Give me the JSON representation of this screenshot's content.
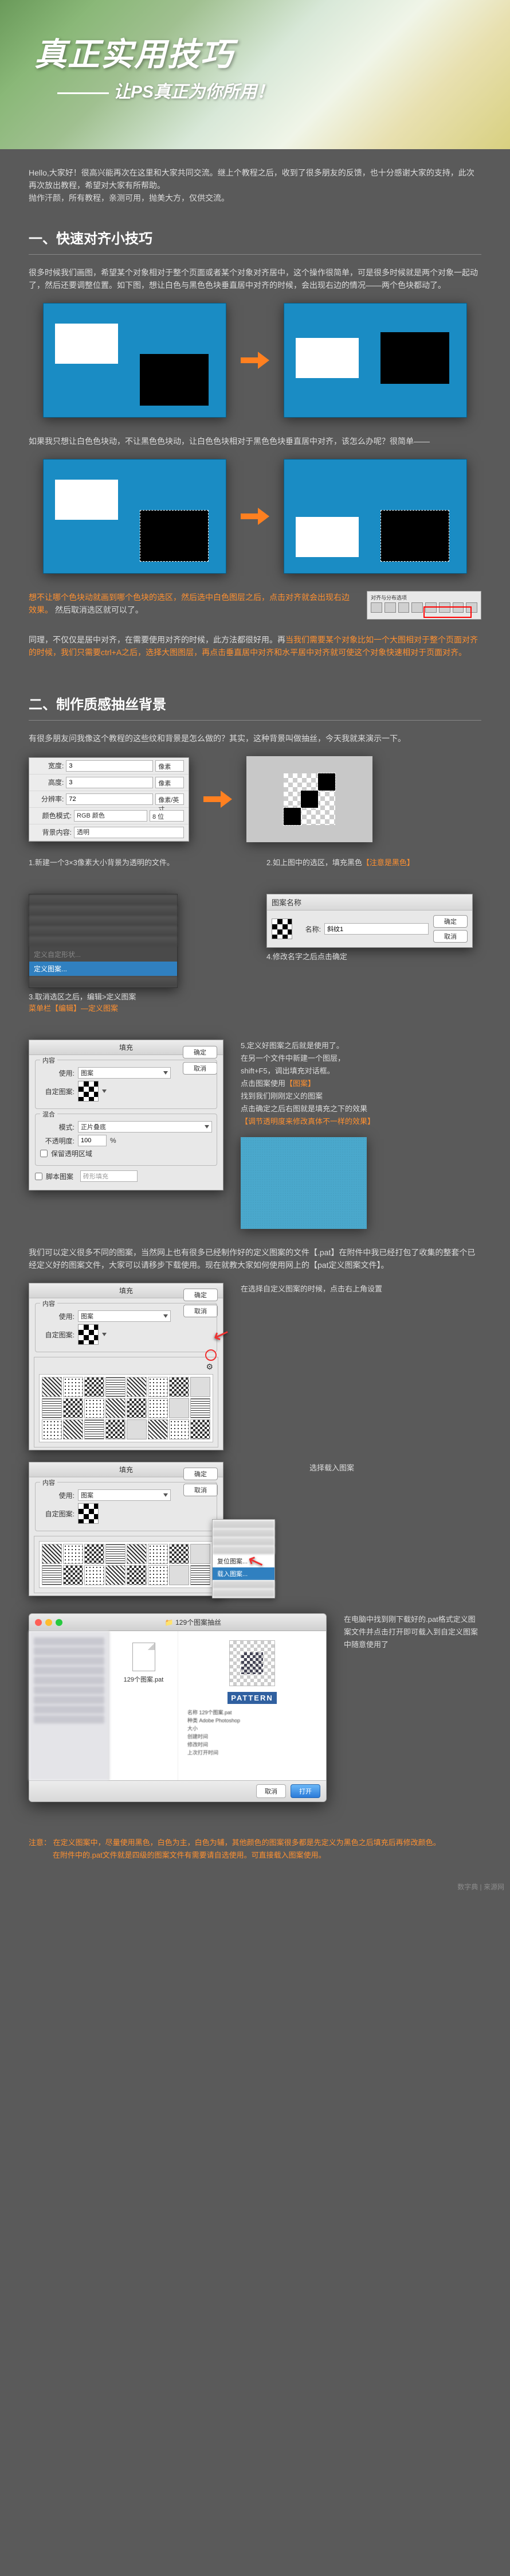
{
  "header": {
    "title_main": "真正实用技巧",
    "title_sub": "让PS真正为你所用！"
  },
  "intro": {
    "p1": "Hello,大家好！很高兴能再次在这里和大家共同交流。继上个教程之后，收到了很多朋友的反馈，也十分感谢大家的支持，此次再次放出教程，希望对大家有所帮助。",
    "p2": "抛作汗颜，所有教程，亲测可用，抛美大方，仅供交流。"
  },
  "section1": {
    "title": "一、快速对齐小技巧",
    "p1": "很多时候我们画图，希望某个对象相对于整个页面或者某个对象对齐居中，这个操作很简单，可是很多时候就是两个对象一起动了，然后还要调整位置。如下图，想让白色与黑色色块垂直居中对齐的时候，会出现右边的情况——两个色块都动了。",
    "p2": "如果我只想让白色色块动，不让黑色色块动，让白色色块相对于黑色色块垂直居中对齐，该怎么办呢？很简单——",
    "p3_a": "想不让哪个色块动就画到哪个色块的选区，然后选中白色图层之后，点击对齐就会出现右边效果。",
    "p3_note": "然后取消选区就可以了。",
    "align_label": "对齐与分布选项",
    "p4_a": "同理，不仅仅是居中对齐，在需要使用对齐的时候，此方法都很好用。再",
    "p4_b": "当我们需要某个对象比如一个大图相对于整个页面对齐的时候，我们只需要ctrl+A之后，选择大图图层，再点击垂直居中对齐和水平居中对齐就可使这个对象快速相对于页面对齐。"
  },
  "section2": {
    "title": "二、制作质感抽丝背景",
    "p1": "有很多朋友问我像这个教程的这些纹和背景是怎么做的？其实，这种背景叫做抽丝，今天我就来演示一下。",
    "new_doc": {
      "width_lbl": "宽度:",
      "width_val": "3",
      "unit_px": "像素",
      "height_lbl": "高度:",
      "height_val": "3",
      "res_lbl": "分辨率:",
      "res_val": "72",
      "res_unit": "像素/英寸",
      "mode_lbl": "颜色模式:",
      "mode_val": "RGB 颜色",
      "mode_bits": "8 位",
      "bg_lbl": "背景内容:",
      "bg_val": "透明"
    },
    "cap1": "1.新建一个3×3像素大小背景为透明的文件。",
    "cap2_a": "2.如上图中的选区，填充黑色",
    "cap2_b": "【注意是黑色】",
    "menu": {
      "item_custom": "定义自定形状...",
      "item_pattern": "定义图案..."
    },
    "cap3_a": "3.取消选区之后，编辑>定义图案",
    "cap3_b": "菜单栏【编辑】—定义图案",
    "name_dlg": {
      "title": "图案名称",
      "lbl": "名称:",
      "val": "斜纹1",
      "ok": "确定",
      "cancel": "取消"
    },
    "cap4": "4.修改名字之后点击确定",
    "fill_dlg": {
      "title": "填充",
      "grp_content": "内容",
      "use_lbl": "使用:",
      "use_val": "图案",
      "pattern_lbl": "自定图案:",
      "grp_blend": "混合",
      "mode_lbl": "模式:",
      "mode_val": "正片叠底",
      "opacity_lbl": "不透明度:",
      "opacity_val": "100",
      "opacity_pct": "%",
      "preserve_lbl": "保留透明区域",
      "ok": "确定",
      "cancel": "取消",
      "script_lbl": "脚本图案",
      "script_val": "砖形填充"
    },
    "cap5": {
      "l1": "5.定义好图案之后就是使用了。",
      "l2": "在另一个文件中新建一个图层，",
      "l3": "shift+F5，调出填充对话框。",
      "l4_a": "点击图案使用",
      "l4_b": "【图案】",
      "l5": "找到我们刚刚定义的图案",
      "l6": "点击确定之后右图就是填充之下的效果",
      "l7_a": "【调节透明度来修改真体不一样的效果】"
    },
    "p_lib": "我们可以定义很多不同的图案，当然网上也有很多已经制作好的定义图案的文件【.pat】在附件中我已经打包了收集的整套个已经定义好的图案文件，大家可以请移步下载使用。现在就教大家如何使用网上的【pat定义图案文件】。",
    "cap6": "在选择自定义图案的时候，点击右上角设置",
    "cap7": "选择载入图案",
    "context": {
      "load": "载入图案...",
      "reset": "复位图案..."
    },
    "finder": {
      "title": "129个图案抽丝",
      "file_name": "129个图案.pat",
      "badge": "PATTERN",
      "info_name": "名称 129个图案.pat",
      "info_kind": "种类 Adobe Photoshop",
      "info_size": "大小",
      "info_created": "创建时间",
      "info_mod": "修改时间",
      "info_last": "上次打开时间",
      "btn_cancel": "取消",
      "btn_open": "打开"
    },
    "cap8": "在电脑中找到刚下载好的.pat格式定义图案文件并点击打开即可载入到自定义图案中随意使用了"
  },
  "footer": {
    "lead": "注意：",
    "l1": "在定义图案中，尽量使用黑色，白色为主，白色为辅，其他颜色的图案很多都是先定义为黑色之后填充后再修改颜色。",
    "l2": "在附件中的.pat文件就是四级的图案文件有需要请自选使用。可直接载入图案使用。"
  },
  "watermark": "数字典 | 来源网"
}
